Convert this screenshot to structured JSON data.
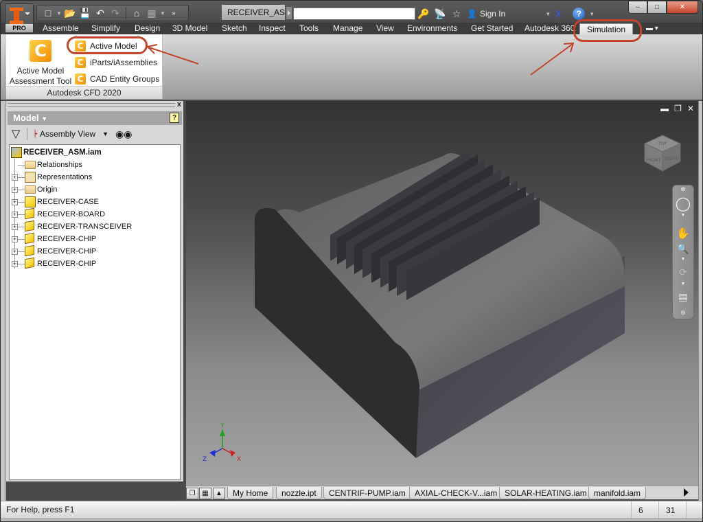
{
  "app": {
    "badge": "PRO",
    "document_title": "RECEIVER_AS...",
    "search_placeholder": "",
    "sign_in": "Sign In"
  },
  "quick_access": {
    "icons": [
      "new-icon",
      "open-icon",
      "save-icon",
      "undo-icon",
      "redo-icon",
      "home-icon",
      "appearance-icon",
      "more-icon"
    ]
  },
  "window_controls": {
    "minimize": "–",
    "restore": "□",
    "close": "✕"
  },
  "ribbon_tabs": [
    {
      "label": "Assemble",
      "active": false
    },
    {
      "label": "Simplify",
      "active": false
    },
    {
      "label": "Design",
      "active": false
    },
    {
      "label": "3D Model",
      "active": false
    },
    {
      "label": "Sketch",
      "active": false
    },
    {
      "label": "Inspect",
      "active": false
    },
    {
      "label": "Tools",
      "active": false
    },
    {
      "label": "Manage",
      "active": false
    },
    {
      "label": "View",
      "active": false
    },
    {
      "label": "Environments",
      "active": false
    },
    {
      "label": "Get Started",
      "active": false
    },
    {
      "label": "Autodesk 360",
      "active": false
    },
    {
      "label": "Simulation",
      "active": true
    }
  ],
  "ribbon_panel": {
    "title": "Autodesk CFD 2020",
    "big_button": {
      "line1": "Active Model",
      "line2": "Assessment Tool"
    },
    "small_buttons": [
      {
        "label": "Active Model"
      },
      {
        "label": "iParts/iAssemblies"
      },
      {
        "label": "CAD Entity Groups"
      }
    ]
  },
  "browser": {
    "title": "Model",
    "view_selector": "Assembly View",
    "close": "x",
    "help": "?",
    "tree": {
      "root": "RECEIVER_ASM.iam",
      "items": [
        {
          "label": "Relationships",
          "icon": "folder",
          "expandable": false
        },
        {
          "label": "Representations",
          "icon": "representations",
          "expandable": true
        },
        {
          "label": "Origin",
          "icon": "folder",
          "expandable": true
        },
        {
          "label": "RECEIVER-CASE",
          "icon": "grounded-part",
          "expandable": true
        },
        {
          "label": "RECEIVER-BOARD",
          "icon": "part",
          "expandable": true
        },
        {
          "label": "RECEIVER-TRANSCEIVER",
          "icon": "part",
          "expandable": true
        },
        {
          "label": "RECEIVER-CHIP",
          "icon": "part",
          "expandable": true
        },
        {
          "label": "RECEIVER-CHIP",
          "icon": "part",
          "expandable": true
        },
        {
          "label": "RECEIVER-CHIP",
          "icon": "part",
          "expandable": true
        }
      ]
    }
  },
  "viewport": {
    "viewcube_faces": [
      "TOP",
      "FRONT",
      "RIGHT"
    ],
    "triad_axes": [
      "X",
      "Y",
      "Z"
    ],
    "axis_colors": {
      "x": "#d02020",
      "y": "#20a020",
      "z": "#2030d0"
    },
    "navbar_tools": [
      "steering-wheel-icon",
      "pan-icon",
      "zoom-icon",
      "orbit-icon",
      "view-face-icon"
    ]
  },
  "document_tabs": [
    {
      "label": "My Home"
    },
    {
      "label": "nozzle.ipt"
    },
    {
      "label": "CENTRIF-PUMP.iam"
    },
    {
      "label": "AXIAL-CHECK-V...iam"
    },
    {
      "label": "SOLAR-HEATING.iam"
    },
    {
      "label": "manifold.iam"
    }
  ],
  "status_bar": {
    "help_text": "For Help, press F1",
    "count1": "6",
    "count2": "31"
  },
  "colors": {
    "accent_callout": "#c0452b",
    "cfd_icon": "#f5a000",
    "tab_bar": "#3d3d3d"
  }
}
